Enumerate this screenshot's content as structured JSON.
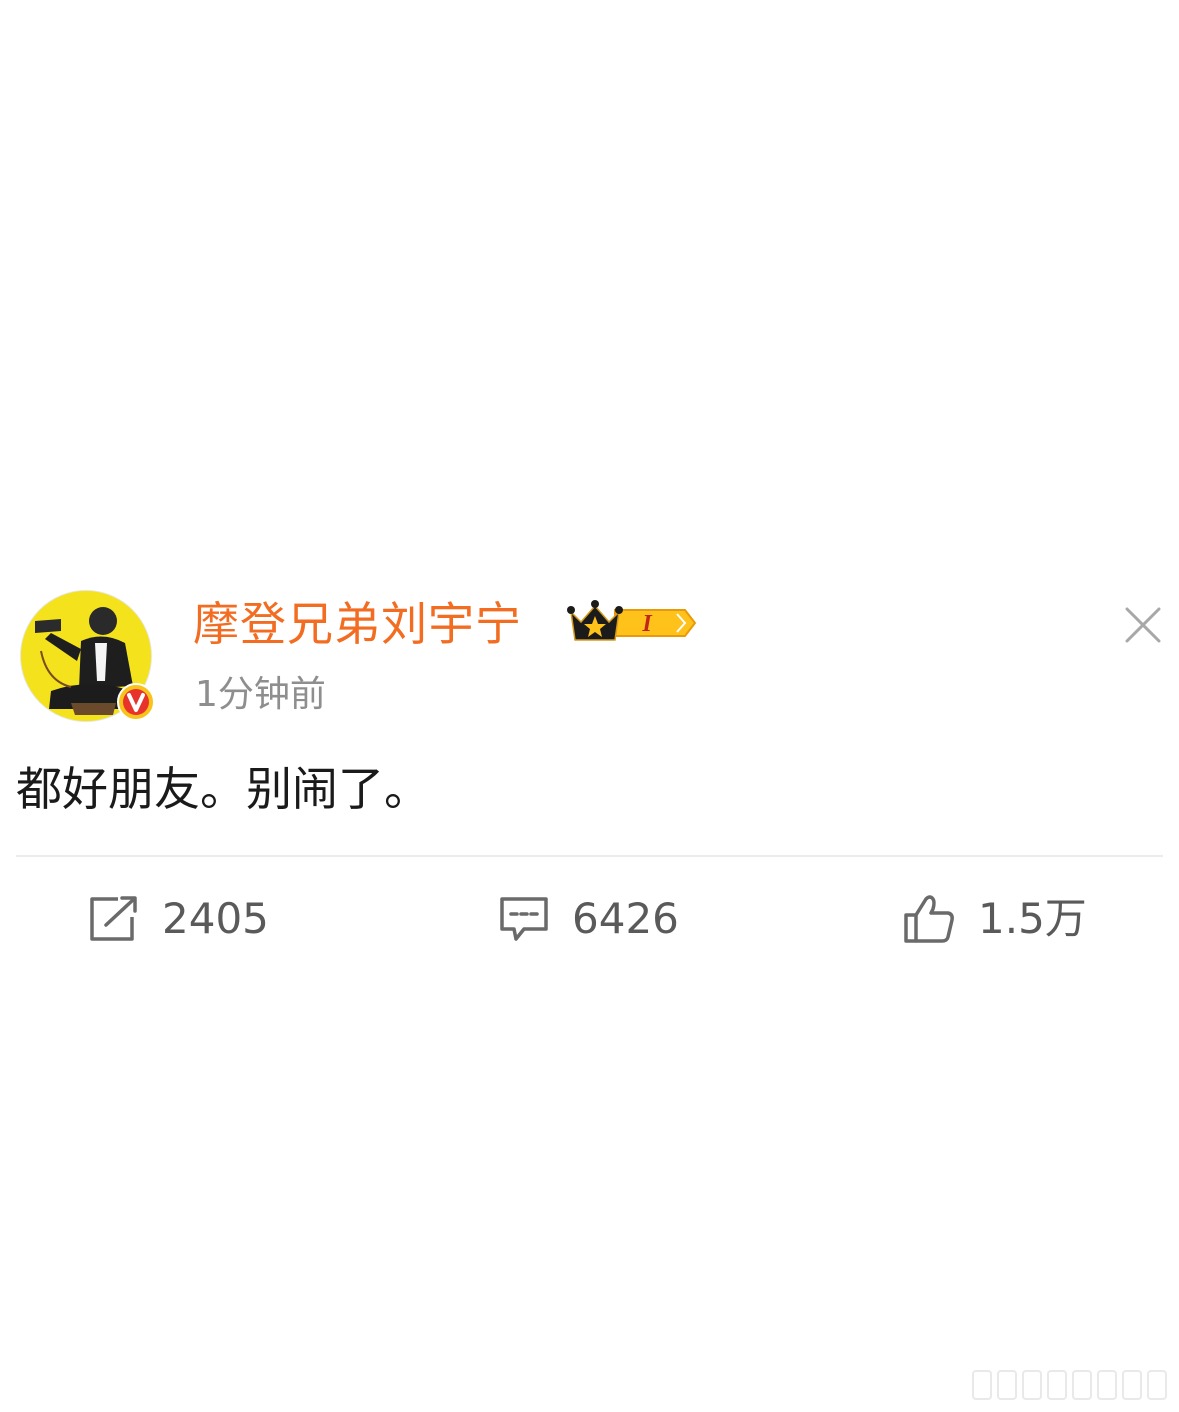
{
  "post": {
    "author": {
      "name": "摩登兄弟刘宇宁",
      "avatar_icon": "avatar-photo",
      "verified_icon": "verified-v-icon",
      "verified_color": "#e8322c",
      "member_badge_icon": "crown-member-icon",
      "member_level": "I",
      "name_color": "#f26d22"
    },
    "timestamp": "1分钟前",
    "text": "都好朋友。别闹了。",
    "actions": {
      "repost": {
        "icon": "repost-icon",
        "count": "2405"
      },
      "comment": {
        "icon": "comment-icon",
        "count": "6426"
      },
      "like": {
        "icon": "thumbs-up-icon",
        "count": "1.5万"
      }
    },
    "close_icon": "close-icon"
  }
}
